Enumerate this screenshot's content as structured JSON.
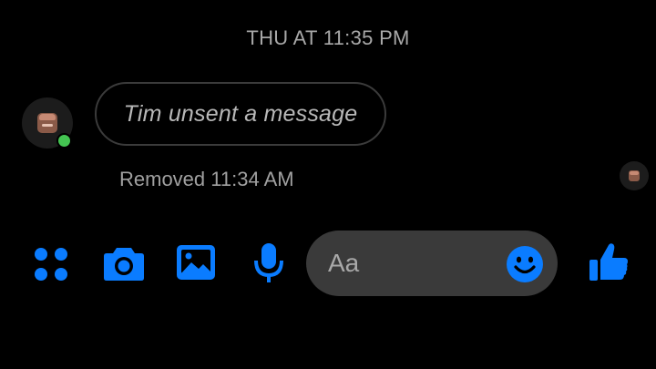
{
  "conversation": {
    "timestamp": "THU AT 11:35 PM",
    "unsent_notice": "Tim unsent a message",
    "removed_label": "Removed 11:34 AM"
  },
  "composer": {
    "input_placeholder": "Aa",
    "input_value": "",
    "icons": [
      "menu-icon",
      "camera-icon",
      "gallery-icon",
      "mic-icon",
      "emoji-icon",
      "like-icon"
    ]
  },
  "colors": {
    "accent": "#0a7cff",
    "online": "#44c552",
    "input_background": "#3a3a3a",
    "bubble_border": "#3b3b3b"
  }
}
